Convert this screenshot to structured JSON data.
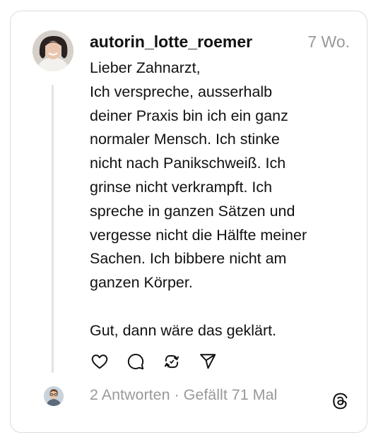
{
  "post": {
    "username": "autorin_lotte_roemer",
    "time": "7 Wo.",
    "text_lines": [
      "Lieber Zahnarzt,",
      "Ich verspreche, ausserhalb",
      "deiner Praxis bin ich ein ganz",
      "normaler Mensch. Ich stinke",
      "nicht nach Panikschweiß. Ich",
      "grinse nicht verkrampft. Ich",
      "spreche in ganzen Sätzen und",
      "vergesse nicht die Hälfte meiner",
      "Sachen. Ich bibbere nicht am",
      "ganzen Körper.",
      "",
      "Gut, dann wäre das geklärt."
    ]
  },
  "actions": {
    "icons": [
      "heart-icon",
      "comment-icon",
      "repost-icon",
      "share-icon"
    ]
  },
  "footer": {
    "replies": "2 Antworten",
    "separator": " · ",
    "likes": "Gefällt 71 Mal",
    "logo_icon": "threads-logo-icon"
  },
  "colors": {
    "text": "#111111",
    "muted": "#999999",
    "border": "#dcdcdc",
    "thread_line": "#e3e3e3"
  }
}
